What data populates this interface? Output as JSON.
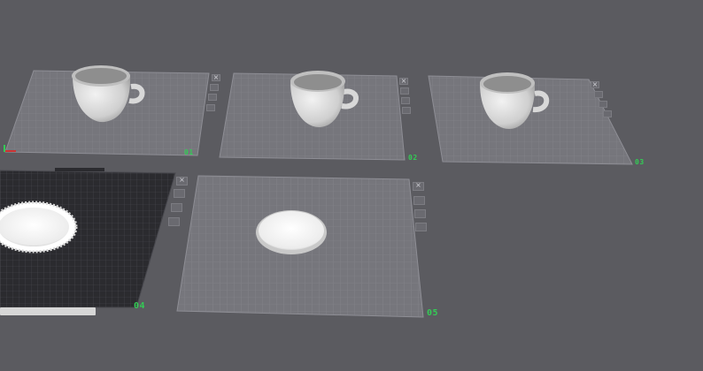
{
  "plates": [
    {
      "id": "plate-1",
      "label": "01"
    },
    {
      "id": "plate-2",
      "label": "02"
    },
    {
      "id": "plate-3",
      "label": "03"
    },
    {
      "id": "plate-4",
      "label": "04"
    },
    {
      "id": "plate-5",
      "label": "05"
    }
  ],
  "objects": [
    {
      "name": "cup-model-1",
      "type": "cup"
    },
    {
      "name": "cup-model-2",
      "type": "cup"
    },
    {
      "name": "cup-model-3",
      "type": "cup"
    },
    {
      "name": "saucer-model-4",
      "type": "saucer"
    },
    {
      "name": "saucer-model-5",
      "type": "saucer"
    }
  ],
  "plate_tools": [
    "close-icon",
    "settings-icon",
    "lock-icon",
    "arrange-icon"
  ],
  "colors": {
    "background": "#5b5b60",
    "plate_fill": "#76767c",
    "plate_grid": "#8d8d94",
    "dark_plate_fill": "#2b2b2f",
    "label_green": "#33cc55",
    "model_white": "#e6e6e6"
  }
}
